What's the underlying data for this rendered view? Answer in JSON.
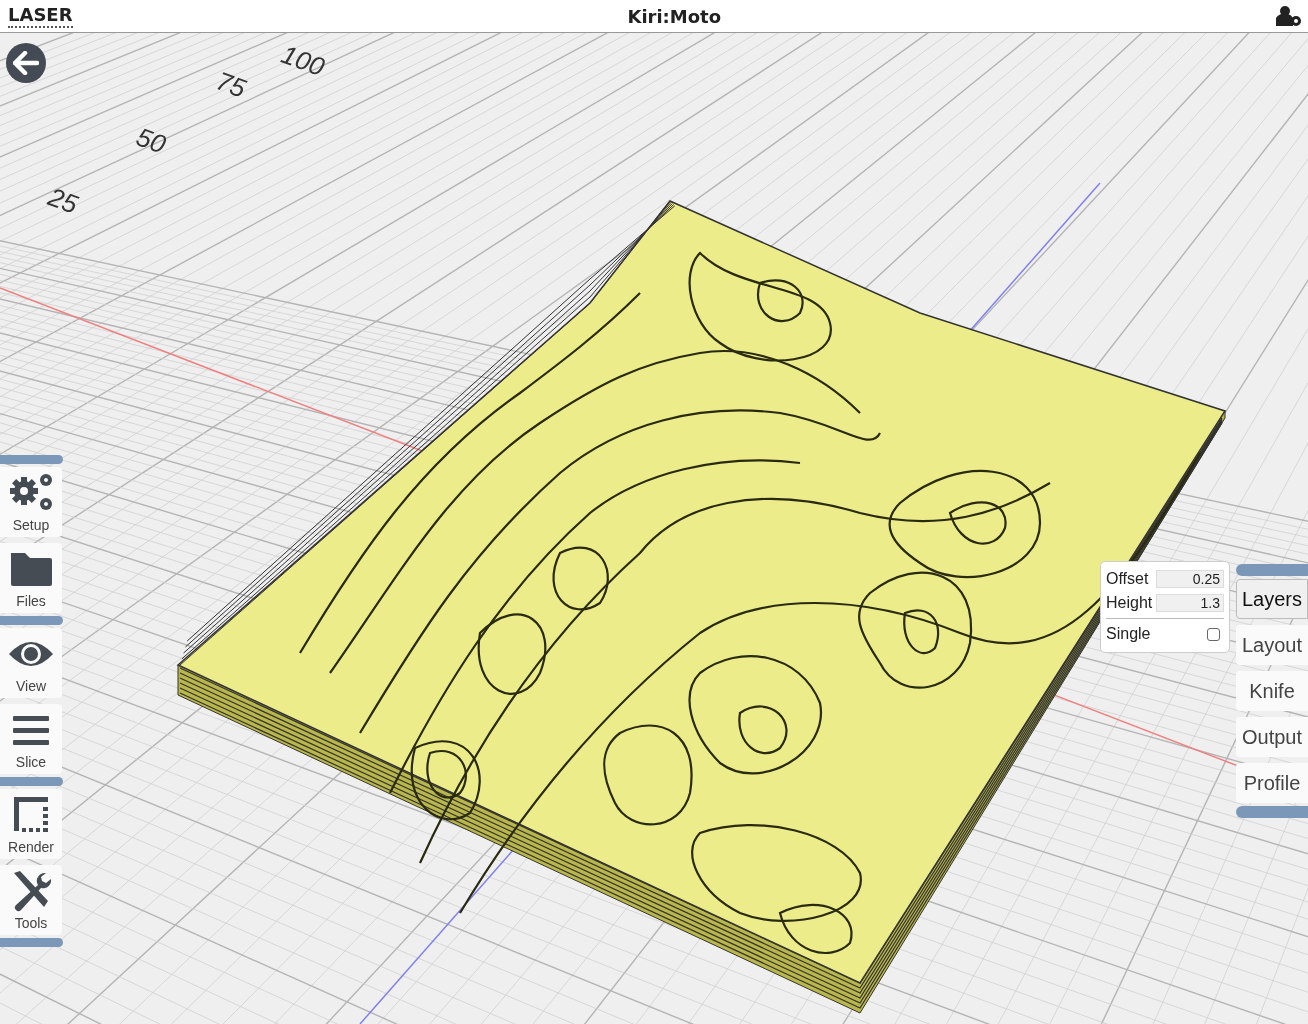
{
  "header": {
    "mode": "LASER",
    "title": "Kiri:Moto"
  },
  "scene": {
    "axis_labels": [
      "100",
      "75",
      "50",
      "25"
    ]
  },
  "left_menu": {
    "groups": [
      {
        "items": [
          {
            "label": "Setup",
            "kind": "gears"
          },
          {
            "label": "Files",
            "kind": "folder"
          }
        ]
      },
      {
        "items": [
          {
            "label": "View",
            "kind": "eye"
          },
          {
            "label": "Slice",
            "kind": "bars"
          }
        ]
      },
      {
        "items": [
          {
            "label": "Render",
            "kind": "render"
          },
          {
            "label": "Tools",
            "kind": "tools"
          }
        ]
      }
    ]
  },
  "layer_panel": {
    "fields": [
      {
        "label": "Offset",
        "value": "0.25"
      },
      {
        "label": "Height",
        "value": "1.3"
      }
    ],
    "single": {
      "label": "Single",
      "checked": false
    }
  },
  "right_menu": {
    "items": [
      {
        "label": "Layers",
        "selected": true
      },
      {
        "label": "Layout",
        "selected": false
      },
      {
        "label": "Knife",
        "selected": false
      },
      {
        "label": "Output",
        "selected": false
      },
      {
        "label": "Profile",
        "selected": false
      }
    ]
  }
}
